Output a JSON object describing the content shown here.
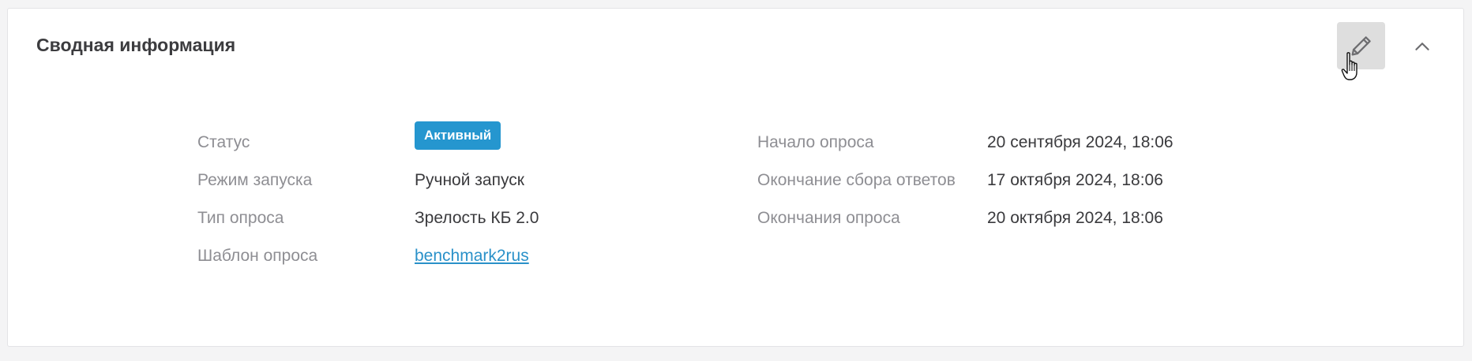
{
  "panel": {
    "title": "Сводная информация",
    "edit_icon": "pencil-icon",
    "collapse_icon": "chevron-up-icon",
    "cursor_icon": "hand-pointer-icon"
  },
  "left": {
    "status": {
      "label": "Статус",
      "value": "Активный",
      "badge_color": "#2596cf"
    },
    "launch_mode": {
      "label": "Режим запуска",
      "value": "Ручной запуск"
    },
    "survey_type": {
      "label": "Тип опроса",
      "value": "Зрелость КБ 2.0"
    },
    "template": {
      "label": "Шаблон опроса",
      "value": "benchmark2rus",
      "link_color": "#2a91c9"
    }
  },
  "right": {
    "start": {
      "label": "Начало опроса",
      "value": "20 сентября 2024, 18:06"
    },
    "answers_end": {
      "label": "Окончание сбора ответов",
      "value": "17 октября 2024, 18:06"
    },
    "survey_end": {
      "label": "Окончания опроса",
      "value": "20 октября 2024, 18:06"
    }
  }
}
